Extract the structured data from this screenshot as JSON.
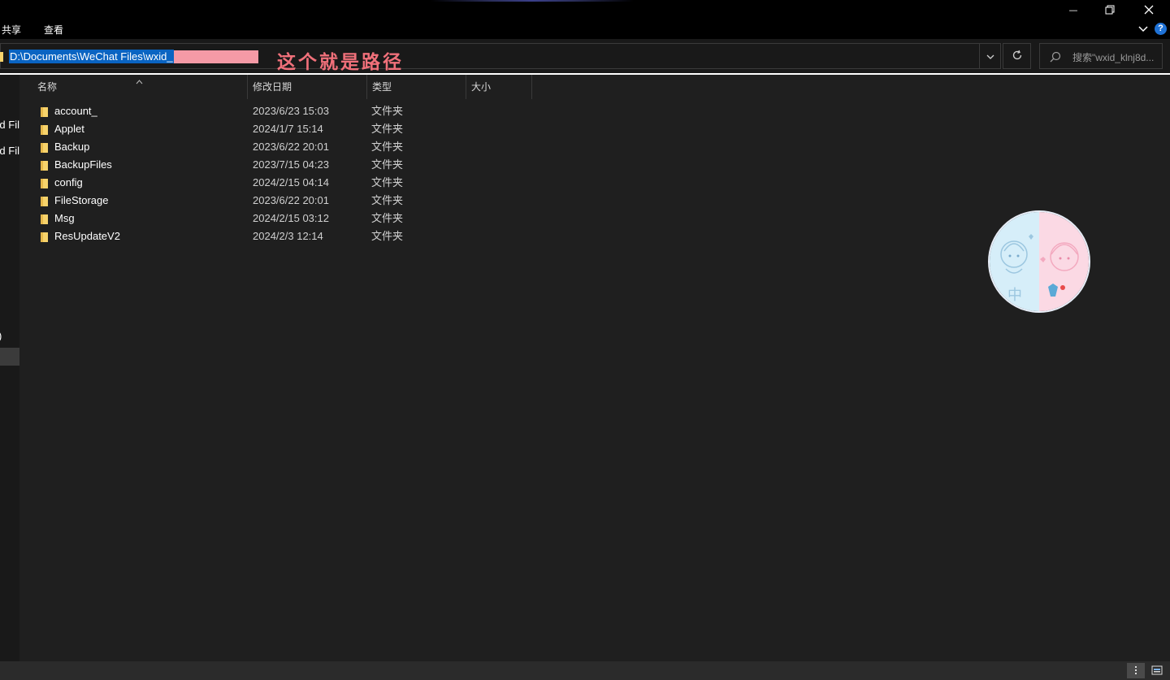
{
  "window": {
    "minimize_glyph": "—",
    "restore_glyph": "❐",
    "close_glyph": "✕"
  },
  "ribbon": {
    "tabs": [
      "共享",
      "查看"
    ],
    "help_glyph": "?"
  },
  "address": {
    "path": "D:\\Documents\\WeChat Files\\wxid_",
    "annotation": "这个就是路径"
  },
  "search": {
    "placeholder": "搜索\"wxid_klnj8d..."
  },
  "nav": {
    "items": [
      "nd Fil",
      "nd Fil",
      ")"
    ]
  },
  "columns": {
    "name": "名称",
    "modified": "修改日期",
    "type": "类型",
    "size": "大小"
  },
  "files": [
    {
      "name": "account_",
      "modified": "2023/6/23 15:03",
      "type": "文件夹"
    },
    {
      "name": "Applet",
      "modified": "2024/1/7 15:14",
      "type": "文件夹"
    },
    {
      "name": "Backup",
      "modified": "2023/6/22 20:01",
      "type": "文件夹"
    },
    {
      "name": "BackupFiles",
      "modified": "2023/7/15 04:23",
      "type": "文件夹"
    },
    {
      "name": "config",
      "modified": "2024/2/15 04:14",
      "type": "文件夹"
    },
    {
      "name": "FileStorage",
      "modified": "2023/6/22 20:01",
      "type": "文件夹"
    },
    {
      "name": "Msg",
      "modified": "2024/2/15 03:12",
      "type": "文件夹"
    },
    {
      "name": "ResUpdateV2",
      "modified": "2024/2/3 12:14",
      "type": "文件夹"
    }
  ],
  "avatar": {
    "badge_text": "中"
  },
  "colors": {
    "accent_selection": "#0a64c2",
    "annotation": "#f0707a",
    "redaction": "#f59aa6",
    "folder": "#f7d36b"
  }
}
